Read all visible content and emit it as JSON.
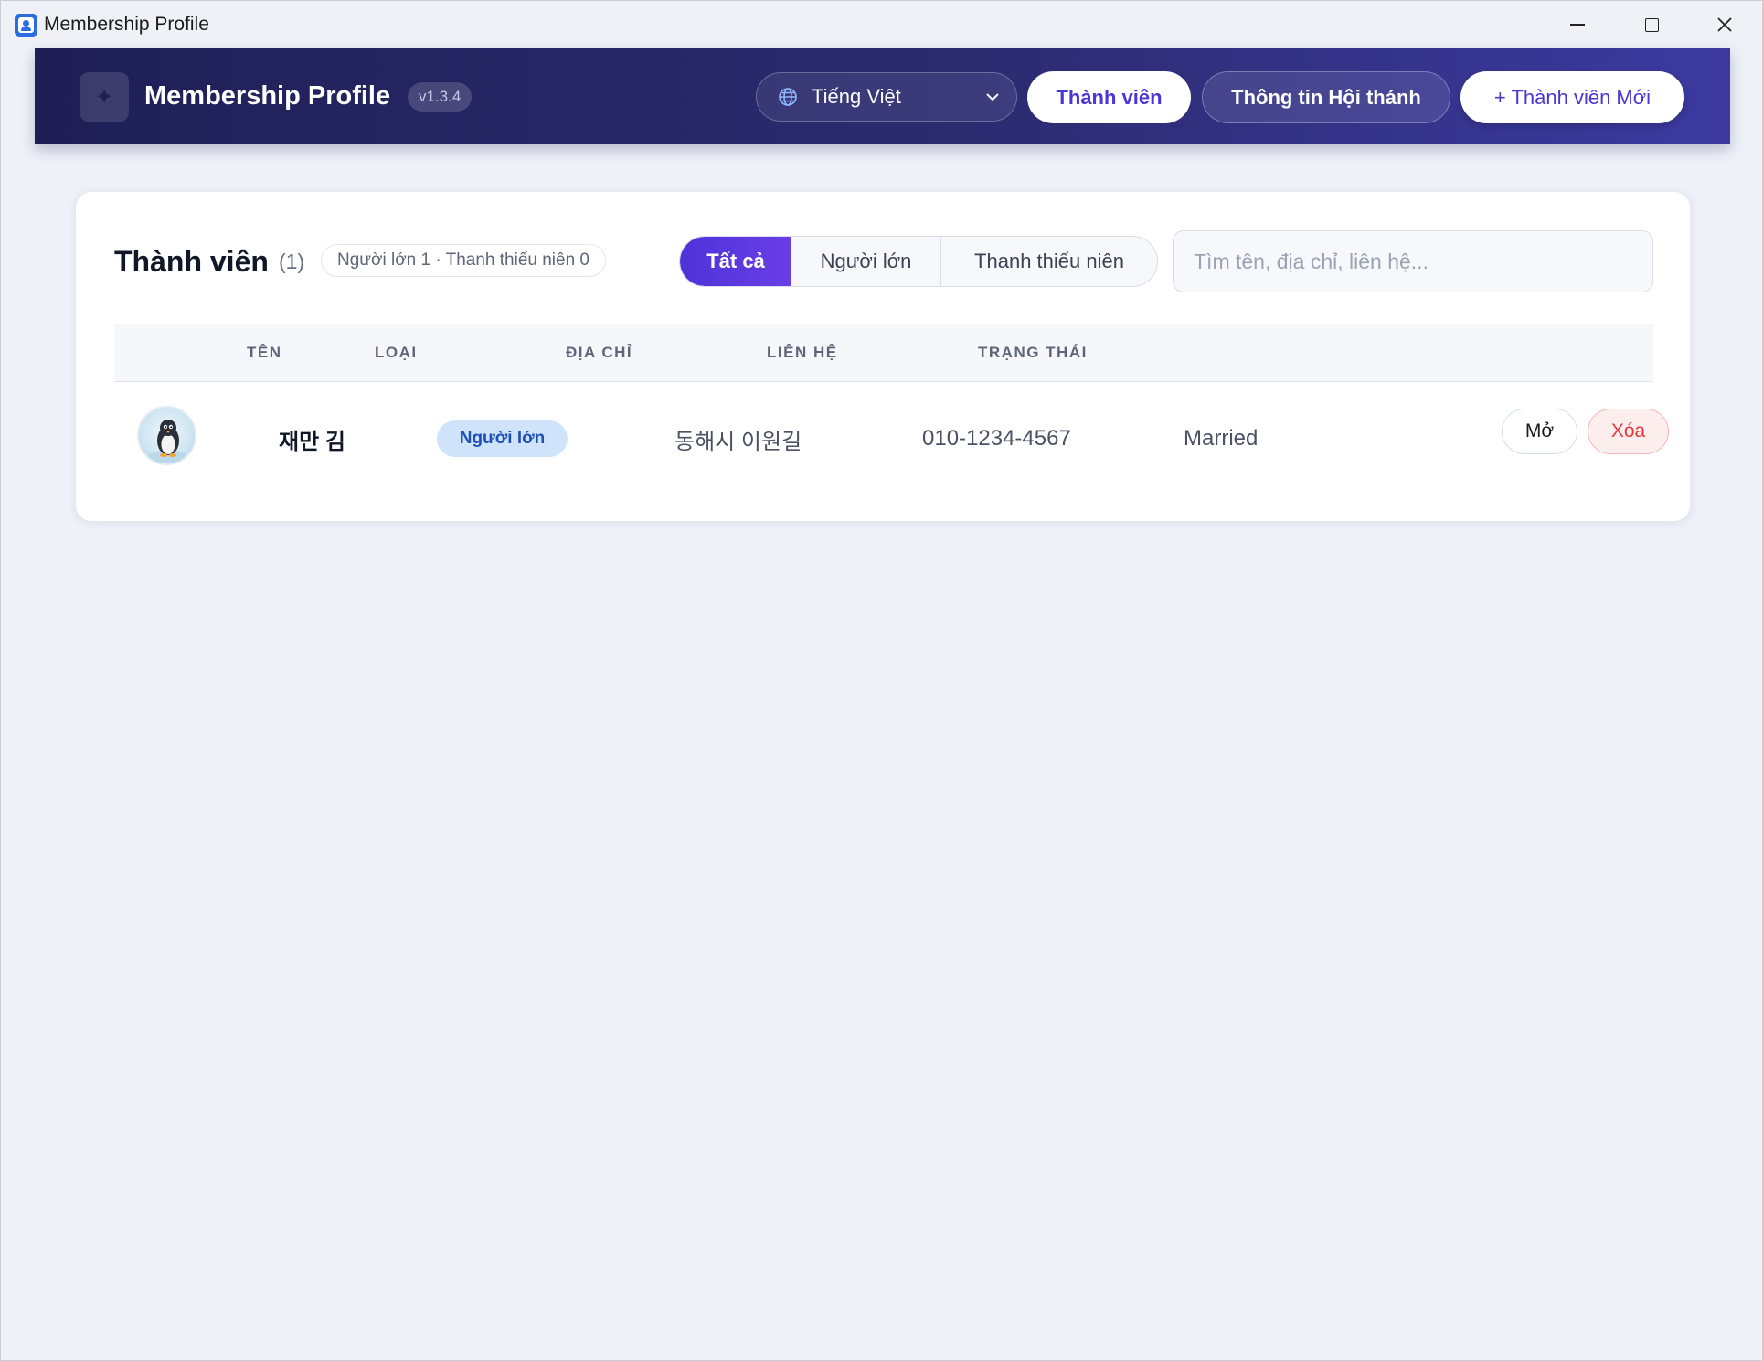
{
  "window": {
    "title": "Membership Profile",
    "icon": "person-card-icon"
  },
  "header": {
    "logo_icon": "sparkle-icon",
    "brand": "Membership Profile",
    "version": "v1.3.4",
    "language": {
      "icon": "globe-icon",
      "selected": "Tiếng Việt"
    },
    "nav": {
      "members": "Thành viên",
      "church_info": "Thông tin Hội thánh",
      "new_member": "+ Thành viên Mới"
    }
  },
  "main": {
    "title": "Thành viên",
    "count": "(1)",
    "summary": "Người lớn 1 · Thanh thiếu niên 0",
    "filters": {
      "all": "Tất cả",
      "adult": "Người lớn",
      "youth": "Thanh thiếu niên",
      "active": "all"
    },
    "search": {
      "placeholder": "Tìm tên, địa chỉ, liên hệ...",
      "value": ""
    },
    "table": {
      "columns": {
        "name": "TÊN",
        "type": "LOẠI",
        "address": "ĐỊA CHỈ",
        "contact": "LIÊN HỆ",
        "status": "TRẠNG THÁI"
      },
      "rows": [
        {
          "avatar": "penguin-avatar",
          "name": "재만 김",
          "type": "Người lớn",
          "address": "동해시 이원길",
          "contact": "010-1234-4567",
          "status": "Married",
          "open_label": "Mở",
          "delete_label": "Xóa"
        }
      ]
    }
  },
  "colors": {
    "accent": "#4a35d6",
    "header_start": "#1f1f56",
    "header_end": "#3c3aa0",
    "danger": "#e0393e",
    "badge_bg": "#cfe3fb"
  }
}
